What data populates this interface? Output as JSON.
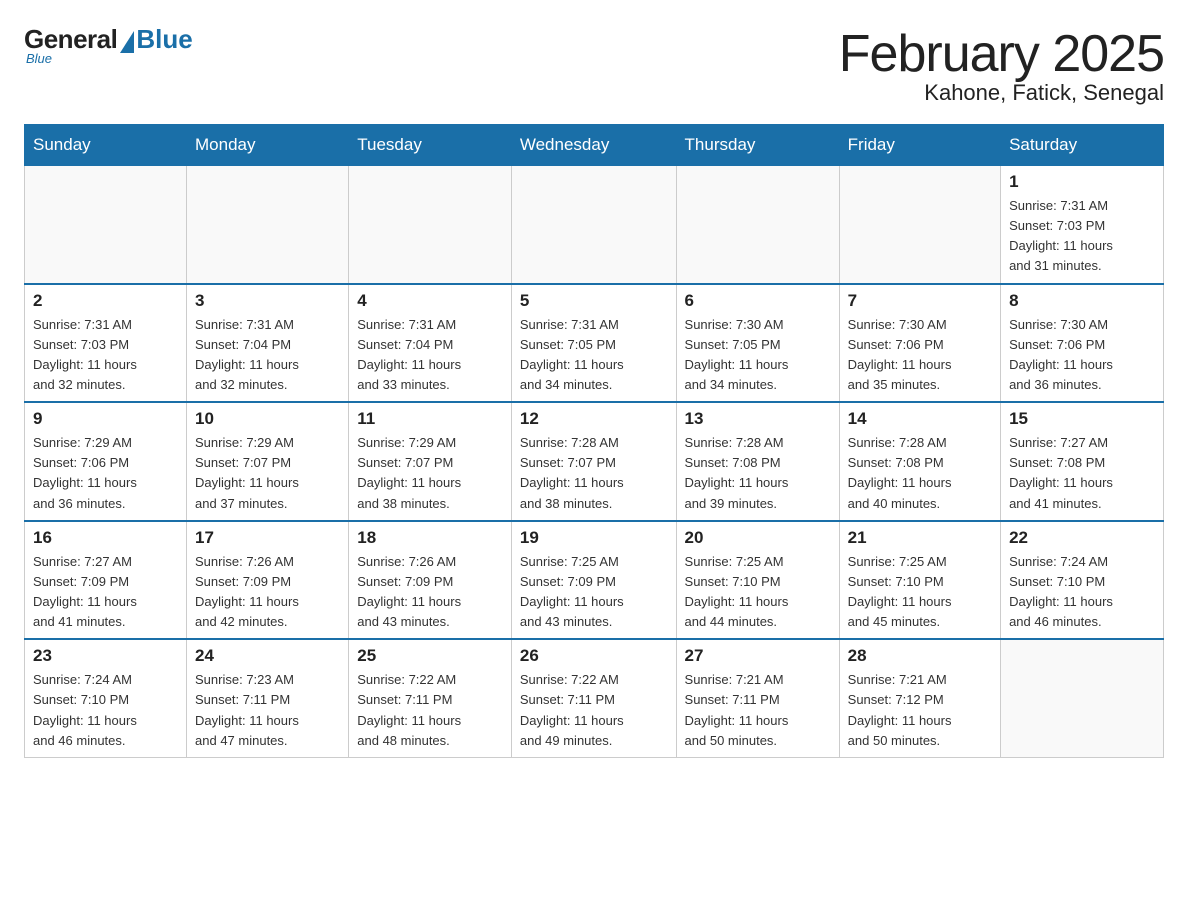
{
  "header": {
    "logo": {
      "general": "General",
      "blue": "Blue",
      "subtitle": "Blue"
    },
    "title": "February 2025",
    "location": "Kahone, Fatick, Senegal"
  },
  "weekdays": [
    "Sunday",
    "Monday",
    "Tuesday",
    "Wednesday",
    "Thursday",
    "Friday",
    "Saturday"
  ],
  "weeks": [
    [
      {
        "day": "",
        "info": ""
      },
      {
        "day": "",
        "info": ""
      },
      {
        "day": "",
        "info": ""
      },
      {
        "day": "",
        "info": ""
      },
      {
        "day": "",
        "info": ""
      },
      {
        "day": "",
        "info": ""
      },
      {
        "day": "1",
        "info": "Sunrise: 7:31 AM\nSunset: 7:03 PM\nDaylight: 11 hours\nand 31 minutes."
      }
    ],
    [
      {
        "day": "2",
        "info": "Sunrise: 7:31 AM\nSunset: 7:03 PM\nDaylight: 11 hours\nand 32 minutes."
      },
      {
        "day": "3",
        "info": "Sunrise: 7:31 AM\nSunset: 7:04 PM\nDaylight: 11 hours\nand 32 minutes."
      },
      {
        "day": "4",
        "info": "Sunrise: 7:31 AM\nSunset: 7:04 PM\nDaylight: 11 hours\nand 33 minutes."
      },
      {
        "day": "5",
        "info": "Sunrise: 7:31 AM\nSunset: 7:05 PM\nDaylight: 11 hours\nand 34 minutes."
      },
      {
        "day": "6",
        "info": "Sunrise: 7:30 AM\nSunset: 7:05 PM\nDaylight: 11 hours\nand 34 minutes."
      },
      {
        "day": "7",
        "info": "Sunrise: 7:30 AM\nSunset: 7:06 PM\nDaylight: 11 hours\nand 35 minutes."
      },
      {
        "day": "8",
        "info": "Sunrise: 7:30 AM\nSunset: 7:06 PM\nDaylight: 11 hours\nand 36 minutes."
      }
    ],
    [
      {
        "day": "9",
        "info": "Sunrise: 7:29 AM\nSunset: 7:06 PM\nDaylight: 11 hours\nand 36 minutes."
      },
      {
        "day": "10",
        "info": "Sunrise: 7:29 AM\nSunset: 7:07 PM\nDaylight: 11 hours\nand 37 minutes."
      },
      {
        "day": "11",
        "info": "Sunrise: 7:29 AM\nSunset: 7:07 PM\nDaylight: 11 hours\nand 38 minutes."
      },
      {
        "day": "12",
        "info": "Sunrise: 7:28 AM\nSunset: 7:07 PM\nDaylight: 11 hours\nand 38 minutes."
      },
      {
        "day": "13",
        "info": "Sunrise: 7:28 AM\nSunset: 7:08 PM\nDaylight: 11 hours\nand 39 minutes."
      },
      {
        "day": "14",
        "info": "Sunrise: 7:28 AM\nSunset: 7:08 PM\nDaylight: 11 hours\nand 40 minutes."
      },
      {
        "day": "15",
        "info": "Sunrise: 7:27 AM\nSunset: 7:08 PM\nDaylight: 11 hours\nand 41 minutes."
      }
    ],
    [
      {
        "day": "16",
        "info": "Sunrise: 7:27 AM\nSunset: 7:09 PM\nDaylight: 11 hours\nand 41 minutes."
      },
      {
        "day": "17",
        "info": "Sunrise: 7:26 AM\nSunset: 7:09 PM\nDaylight: 11 hours\nand 42 minutes."
      },
      {
        "day": "18",
        "info": "Sunrise: 7:26 AM\nSunset: 7:09 PM\nDaylight: 11 hours\nand 43 minutes."
      },
      {
        "day": "19",
        "info": "Sunrise: 7:25 AM\nSunset: 7:09 PM\nDaylight: 11 hours\nand 43 minutes."
      },
      {
        "day": "20",
        "info": "Sunrise: 7:25 AM\nSunset: 7:10 PM\nDaylight: 11 hours\nand 44 minutes."
      },
      {
        "day": "21",
        "info": "Sunrise: 7:25 AM\nSunset: 7:10 PM\nDaylight: 11 hours\nand 45 minutes."
      },
      {
        "day": "22",
        "info": "Sunrise: 7:24 AM\nSunset: 7:10 PM\nDaylight: 11 hours\nand 46 minutes."
      }
    ],
    [
      {
        "day": "23",
        "info": "Sunrise: 7:24 AM\nSunset: 7:10 PM\nDaylight: 11 hours\nand 46 minutes."
      },
      {
        "day": "24",
        "info": "Sunrise: 7:23 AM\nSunset: 7:11 PM\nDaylight: 11 hours\nand 47 minutes."
      },
      {
        "day": "25",
        "info": "Sunrise: 7:22 AM\nSunset: 7:11 PM\nDaylight: 11 hours\nand 48 minutes."
      },
      {
        "day": "26",
        "info": "Sunrise: 7:22 AM\nSunset: 7:11 PM\nDaylight: 11 hours\nand 49 minutes."
      },
      {
        "day": "27",
        "info": "Sunrise: 7:21 AM\nSunset: 7:11 PM\nDaylight: 11 hours\nand 50 minutes."
      },
      {
        "day": "28",
        "info": "Sunrise: 7:21 AM\nSunset: 7:12 PM\nDaylight: 11 hours\nand 50 minutes."
      },
      {
        "day": "",
        "info": ""
      }
    ]
  ]
}
